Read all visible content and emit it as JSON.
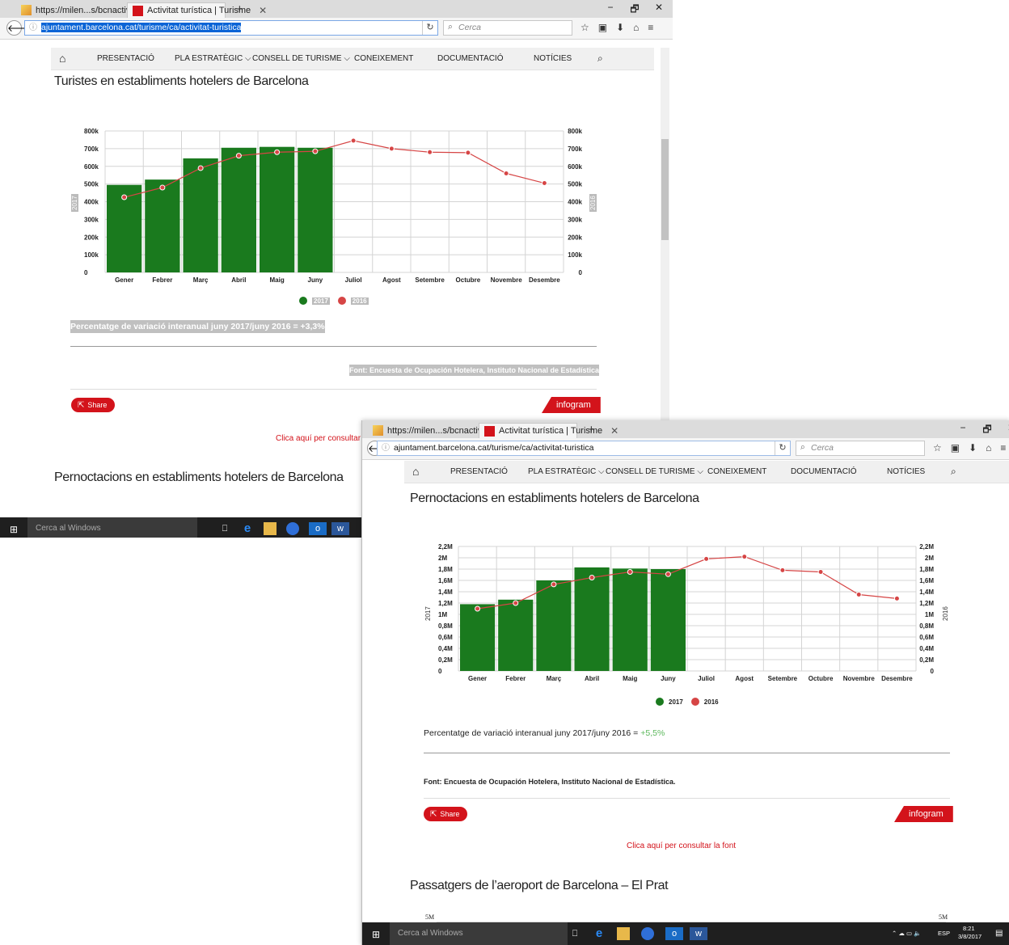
{
  "browser": {
    "tab1": "https://milen...s/bcnactiva/",
    "tab2": "Activitat turística | Turisme",
    "url": "ajuntament.barcelona.cat/turisme/ca/activitat-turistica",
    "search_placeholder": "Cerca",
    "new_tab": "+",
    "win_controls": [
      "−",
      "🗗",
      "✕"
    ]
  },
  "site_nav": {
    "items": [
      "PRESENTACIÓ",
      "PLA ESTRATÈGIC ⌵",
      "CONSELL DE TURISME ⌵",
      "CONEIXEMENT",
      "DOCUMENTACIÓ",
      "NOTÍCIES"
    ]
  },
  "section1": {
    "title": "Turistes en establiments hotelers de Barcelona",
    "variation": "Percentatge de variació interanual juny 2017/juny 2016 = +3,3%",
    "source": "Font: Encuesta de Ocupación Hotelera, Instituto Nacional de Estadística",
    "share": "Share",
    "infogram": "infogram",
    "font_link": "Clica aquí per consultar la font"
  },
  "section2_title_bg": "Pernoctacions en establiments hotelers de Barcelona",
  "section2": {
    "title": "Pernoctacions en establiments hotelers de Barcelona",
    "variation_prefix": "Percentatge de variació interanual juny 2017/juny 2016 = ",
    "variation_value": "+5,5%",
    "source": "Font: Encuesta de Ocupación Hotelera, Instituto Nacional de Estadística.",
    "share": "Share",
    "infogram": "infogram",
    "font_link": "Clica aquí per consultar la font"
  },
  "section3": {
    "title": "Passatgers de l’aeroport de Barcelona – El Prat",
    "y_top_left": "5M",
    "y_top_right": "5M"
  },
  "taskbar": {
    "search": "Cerca al Windows",
    "lang": "ESP",
    "time": "8:21",
    "date": "3/8/2017"
  },
  "colors": {
    "bar2017": "#1a7a1e",
    "line2016": "#d64545",
    "brand_red": "#d3131b"
  },
  "chart_data": [
    {
      "type": "bar",
      "categories": [
        "Gener",
        "Febrer",
        "Març",
        "Abril",
        "Maig",
        "Juny",
        "Juliol",
        "Agost",
        "Setembre",
        "Octubre",
        "Novembre",
        "Desembre"
      ],
      "series": [
        {
          "name": "2017",
          "type": "bar",
          "values": [
            495000,
            525000,
            645000,
            705000,
            710000,
            705000,
            null,
            null,
            null,
            null,
            null,
            null
          ]
        },
        {
          "name": "2016",
          "type": "line",
          "values": [
            425000,
            480000,
            590000,
            660000,
            680000,
            685000,
            745000,
            700000,
            680000,
            677000,
            560000,
            505000
          ]
        }
      ],
      "yticks": [
        "0",
        "100k",
        "200k",
        "300k",
        "400k",
        "500k",
        "600k",
        "700k",
        "800k"
      ],
      "ylim": [
        0,
        800000
      ],
      "ylabel_left": "2017",
      "ylabel_right": "2016",
      "legend": [
        "2017",
        "2016"
      ],
      "grid": true,
      "legend_position": "bottom"
    },
    {
      "type": "bar",
      "categories": [
        "Gener",
        "Febrer",
        "Març",
        "Abril",
        "Maig",
        "Juny",
        "Juliol",
        "Agost",
        "Setembre",
        "Octubre",
        "Novembre",
        "Desembre"
      ],
      "series": [
        {
          "name": "2017",
          "type": "bar",
          "values": [
            1180000,
            1260000,
            1600000,
            1830000,
            1810000,
            1800000,
            null,
            null,
            null,
            null,
            null,
            null
          ]
        },
        {
          "name": "2016",
          "type": "line",
          "values": [
            1100000,
            1200000,
            1530000,
            1650000,
            1750000,
            1710000,
            1980000,
            2020000,
            1780000,
            1750000,
            1350000,
            1280000
          ]
        }
      ],
      "yticks": [
        "0",
        "0,2M",
        "0,4M",
        "0,6M",
        "0,8M",
        "1M",
        "1,2M",
        "1,4M",
        "1,6M",
        "1,8M",
        "2M",
        "2,2M"
      ],
      "ylim": [
        0,
        2200000
      ],
      "ylabel_left": "2017",
      "ylabel_right": "2016",
      "legend": [
        "2017",
        "2016"
      ],
      "grid": true,
      "legend_position": "bottom"
    }
  ]
}
